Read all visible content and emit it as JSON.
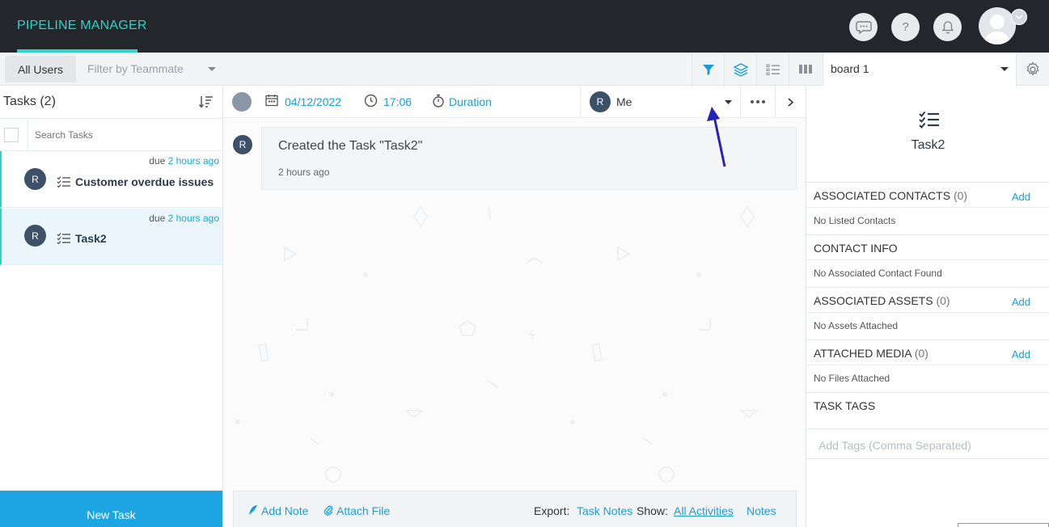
{
  "app": {
    "title": "PIPELINE MANAGER"
  },
  "header_icons": [
    "chat-icon",
    "help-icon",
    "bell-icon",
    "user-avatar"
  ],
  "filters": {
    "all_users": "All Users",
    "teammate_placeholder": "Filter by Teammate",
    "board": "board 1"
  },
  "tasks_panel": {
    "title": "Tasks (2)",
    "search_placeholder": "Search Tasks",
    "items": [
      {
        "due_prefix": "due",
        "due_rel": "2 hours ago",
        "initial": "R",
        "name": "Customer overdue issues"
      },
      {
        "due_prefix": "due",
        "due_rel": "2 hours ago",
        "initial": "R",
        "name": "Task2"
      }
    ],
    "new_task": "New Task"
  },
  "task_bar": {
    "date": "04/12/2022",
    "time": "17:06",
    "duration": "Duration",
    "assignee_initial": "R",
    "assignee": "Me"
  },
  "activity": {
    "initial": "R",
    "title": "Created the Task \"Task2\"",
    "time": "2 hours ago"
  },
  "footer": {
    "add_note": "Add Note",
    "attach_file": "Attach File",
    "export_label": "Export:",
    "task_notes": "Task Notes",
    "show_label": "Show:",
    "all_activities": "All Activities",
    "notes": "Notes"
  },
  "details": {
    "task_name": "Task2",
    "associated_contacts": {
      "title": "ASSOCIATED CONTACTS",
      "count": "(0)",
      "add": "Add",
      "empty": "No Listed Contacts"
    },
    "contact_info": {
      "title": "CONTACT INFO",
      "empty": "No Associated Contact Found"
    },
    "associated_assets": {
      "title": "ASSOCIATED ASSETS",
      "count": "(0)",
      "add": "Add",
      "empty": "No Assets Attached"
    },
    "attached_media": {
      "title": "ATTACHED MEDIA",
      "count": "(0)",
      "add": "Add",
      "empty": "No Files Attached"
    },
    "task_tags": {
      "title": "TASK TAGS",
      "placeholder": "Add Tags (Comma Separated)"
    }
  },
  "colors": {
    "accent": "#2ed3c6",
    "link": "#1a9ed8",
    "primary_button": "#1ea5e4",
    "header_bg": "#23272c",
    "annotation_arrow": "#2424b8"
  }
}
